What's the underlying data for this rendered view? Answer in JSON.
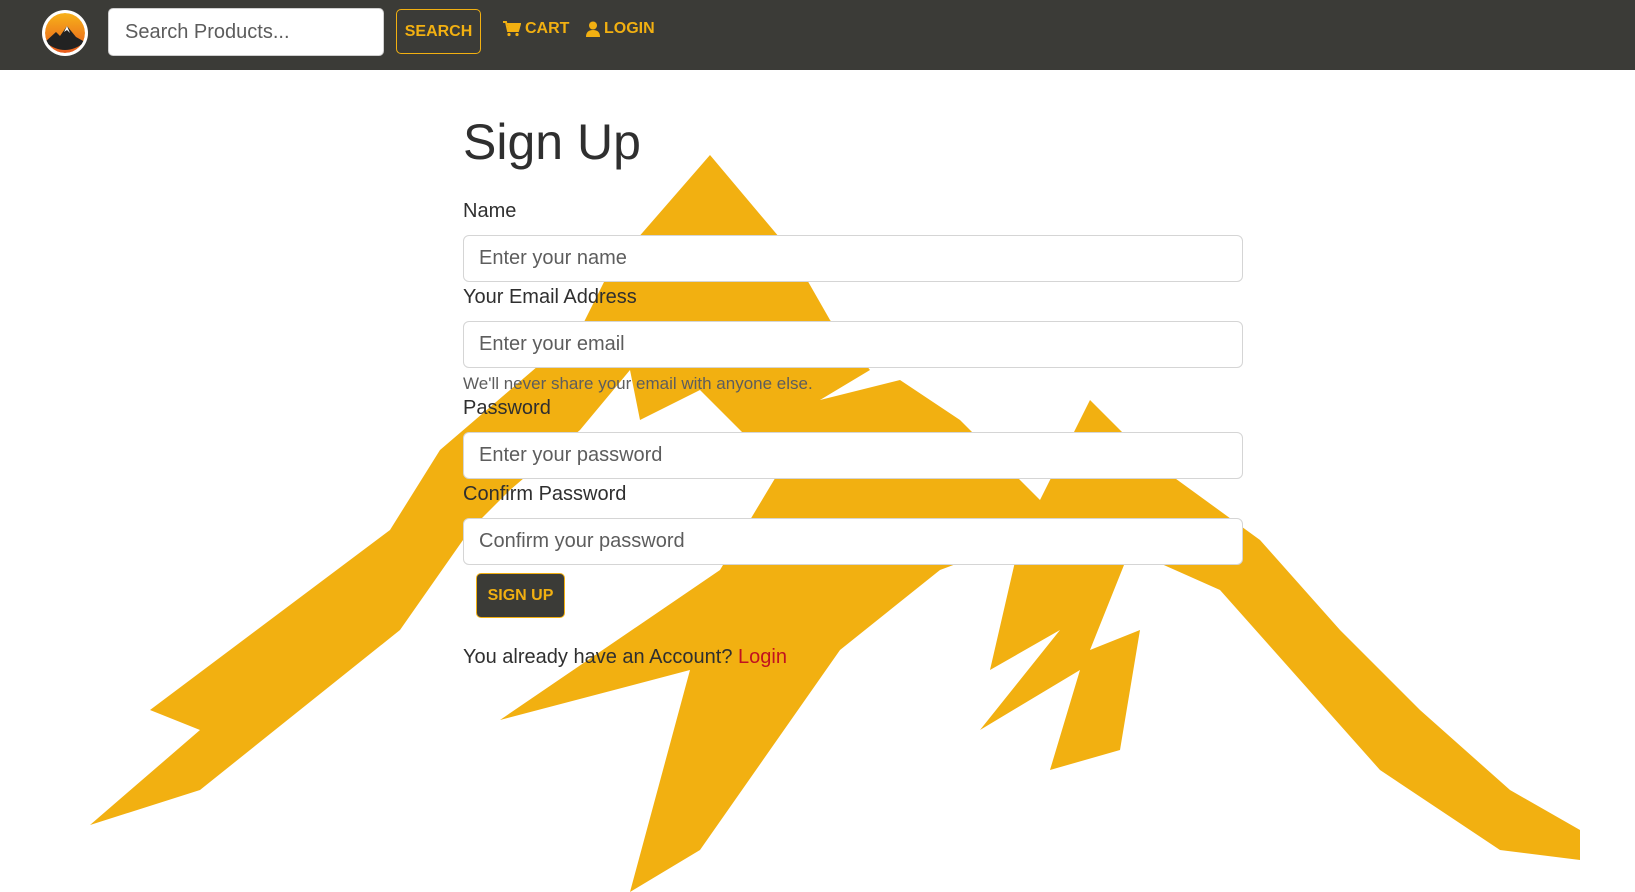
{
  "colors": {
    "navbar_bg": "#3b3b37",
    "accent": "#f2b011",
    "mountain": "#f2b011",
    "link": "#c1121f"
  },
  "navbar": {
    "logo_icon": "mountain-sun-logo",
    "search": {
      "placeholder": "Search Products...",
      "value": ""
    },
    "search_button": "SEARCH",
    "cart": {
      "icon": "cart-icon",
      "label": "CART"
    },
    "login": {
      "icon": "user-icon",
      "label": "LOGIN"
    }
  },
  "form": {
    "title": "Sign Up",
    "name": {
      "label": "Name",
      "placeholder": "Enter your name"
    },
    "email": {
      "label": "Your Email Address",
      "placeholder": "Enter your email",
      "help": "We'll never share your email with anyone else."
    },
    "password": {
      "label": "Password",
      "placeholder": "Enter your password"
    },
    "confirm": {
      "label": "Confirm Password",
      "placeholder": "Confirm your password"
    },
    "submit": "SIGN UP",
    "footer_text": "You already have an Account? ",
    "footer_link": "Login"
  }
}
